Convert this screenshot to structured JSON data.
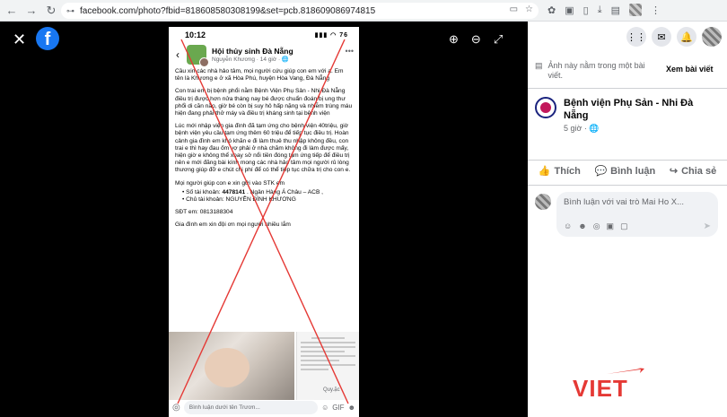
{
  "browser": {
    "url": "facebook.com/photo?fbid=818608580308199&set=pcb.818609086974815",
    "nav": {
      "back": "←",
      "forward": "→",
      "reload": "↻"
    }
  },
  "viewer": {
    "close_label": "✕",
    "logo_letter": "f"
  },
  "phone": {
    "time": "10:12",
    "status_icons": "▮▮▮ ◠ 76",
    "group_name": "Hội thủy sinh Đà Nẵng",
    "author_meta": "Nguyễn Khương · 14 giờ · 🌐",
    "more": "•••",
    "paragraphs": [
      "Cầu xin các nhà hảo tâm, mọi người cứu giúp con em với ạ. Em tên là Khương e ở xã Hòa Phú, huyện Hòa Vang, Đà Nẵng",
      "Con trai em bị bệnh phổi nằm Bệnh Viện Phụ Sản - Nhi Đà Nẵng điều trị được hơn nửa tháng nay bé được chuẩn đoán bị ung thư phổi di căn não, giờ bé còn bị suy hô hấp nặng và nhiễm trùng máu hiện đang phải thở máy và điều trị kháng sinh tại bệnh viện",
      "Lúc mới nhập viện gia đình đã tạm ứng cho bệnh viện 40triệu, giờ bệnh viện yêu cầu tạm ứng thêm 60 triệu để tiếp tục điều trị. Hoàn cảnh gia đình em khó khăn e đi làm thuê thu nhập không đều, con trai e thì hay đau ốm vợ phải ở nhà chăm không đi làm được mấy, hiện giờ e không thể xoay sở nổi tiền đóng tạm ứng tiếp để điều trị nên e mới đăng bài kính mong các nhà hảo tâm mọi người rủ lòng thương giúp đỡ e chút chi phí để có thể tiếp tục chữa trị cho con e.",
      "Mọi người giúp con e xin gửi vào STK em"
    ],
    "bank_label": "Số tài khoản: ",
    "bank_number": "4478141",
    "bank_rest": " . Ngân Hàng Á Châu – ACB ,",
    "holder": "Chủ tài khoản: NGUYỄN ĐÌNH KHƯƠNG",
    "phone_line": "SĐT em: 0813188304",
    "closing": "Gia đình em xin đội ơn mọi người nhiều lắm",
    "quyet_label": "Quy.ặc",
    "comment_placeholder": "Bình luận dưới tên Trươn..."
  },
  "sidebar": {
    "info_text": "Ảnh này nằm trong một bài viết.",
    "view_post": "Xem bài viết",
    "page_name": "Bệnh viện Phụ Sản - Nhi Đà Nẵng",
    "time": "5 giờ · 🌐",
    "actions": [
      {
        "icon": "👍",
        "label": "Thích"
      },
      {
        "icon": "💬",
        "label": "Bình luận"
      },
      {
        "icon": "↪",
        "label": "Chia sẻ"
      }
    ],
    "comment_placeholder": "Bình luận với vai trò Mai Ho X..."
  },
  "watermark": {
    "text": "VIET"
  },
  "colors": {
    "fb_blue": "#1877f2",
    "cross": "#e53935"
  }
}
